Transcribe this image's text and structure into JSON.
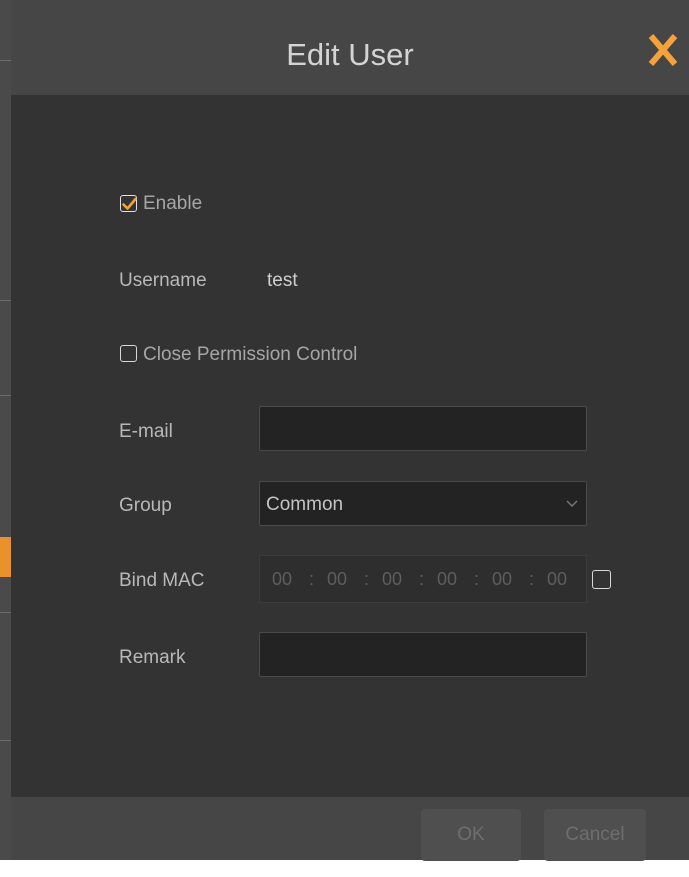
{
  "dialog": {
    "title": "Edit User",
    "close_icon": "close-x-icon",
    "accent_color": "#f4a23c"
  },
  "form": {
    "enable": {
      "label": "Enable",
      "checked": true
    },
    "username": {
      "label": "Username",
      "value": "test"
    },
    "close_permission": {
      "label": "Close Permission Control",
      "checked": false
    },
    "email": {
      "label": "E-mail",
      "value": ""
    },
    "group": {
      "label": "Group",
      "selected": "Common"
    },
    "bind_mac": {
      "label": "Bind MAC",
      "octets": [
        "00",
        "00",
        "00",
        "00",
        "00",
        "00"
      ],
      "separator": ":",
      "checked": false
    },
    "remark": {
      "label": "Remark",
      "value": ""
    }
  },
  "footer": {
    "ok_label": "OK",
    "cancel_label": "Cancel"
  }
}
